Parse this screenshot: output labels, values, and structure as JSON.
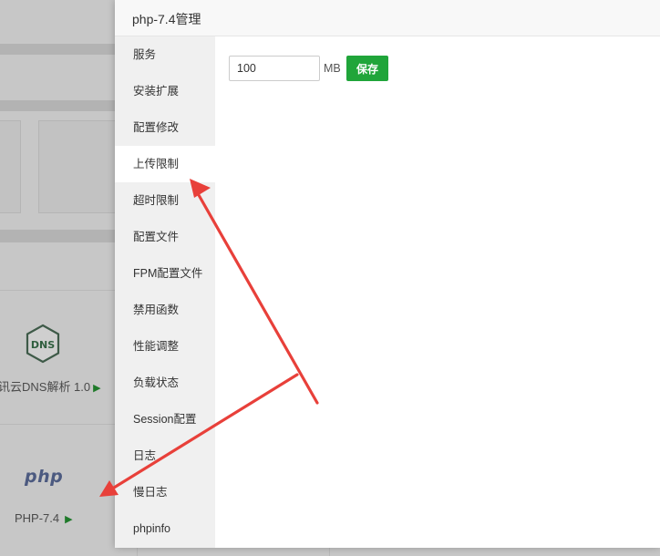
{
  "background": {
    "plugins": [
      {
        "name": "讯云DNS解析 1.0",
        "icon": "dns-icon",
        "icon_text": "DNS"
      },
      {
        "name": "PHP-7.4",
        "icon": "php-logo",
        "icon_text": "php"
      }
    ],
    "play_glyph": "▶"
  },
  "modal": {
    "title": "php-7.4管理",
    "sidebar": [
      {
        "label": "服务"
      },
      {
        "label": "安装扩展"
      },
      {
        "label": "配置修改"
      },
      {
        "label": "上传限制",
        "active": true
      },
      {
        "label": "超时限制"
      },
      {
        "label": "配置文件"
      },
      {
        "label": "FPM配置文件"
      },
      {
        "label": "禁用函数"
      },
      {
        "label": "性能调整"
      },
      {
        "label": "负载状态"
      },
      {
        "label": "Session配置"
      },
      {
        "label": "日志"
      },
      {
        "label": "慢日志"
      },
      {
        "label": "phpinfo"
      }
    ],
    "upload_limit": {
      "value": "100",
      "unit": "MB",
      "save_label": "保存"
    }
  },
  "colors": {
    "accent_green": "#20a53a",
    "annotation_red": "#e8403a"
  }
}
